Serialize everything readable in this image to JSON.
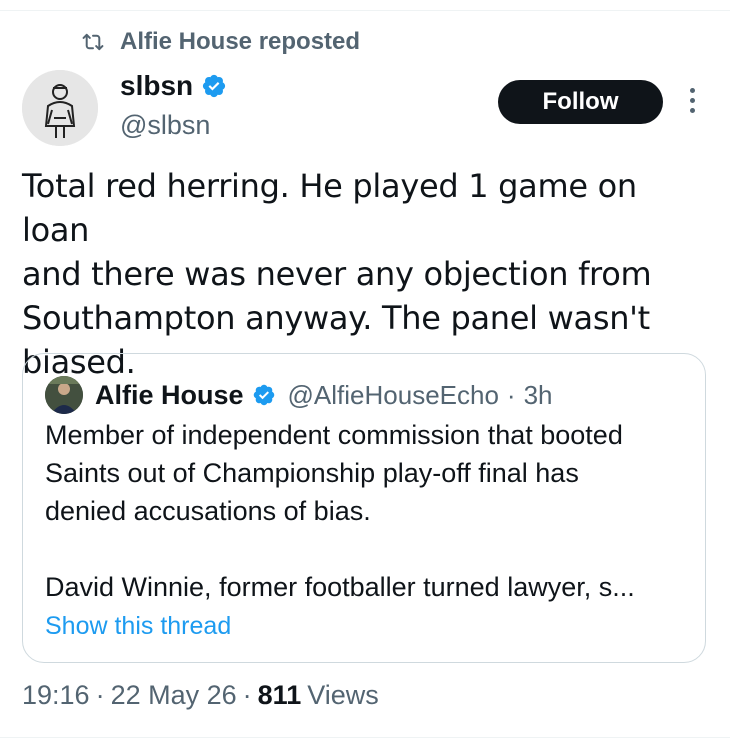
{
  "repost": {
    "text": "Alfie House reposted",
    "icon": "repost-icon"
  },
  "author": {
    "name": "slbsn",
    "handle": "@slbsn",
    "verified": true
  },
  "follow_label": "Follow",
  "post_text": "Total red herring. He played 1 game on loan\nand there was never any objection from\nSouthampton anyway. The panel wasn't\nbiased.",
  "quote": {
    "name": "Alfie House",
    "handle": "@AlfieHouseEcho",
    "separator": "·",
    "time": "3h",
    "text": "Member of independent commission that booted\nSaints out of Championship play-off final has\ndenied accusations of bias.",
    "text2": "David Winnie, former footballer turned lawyer, s...",
    "link": "Show this thread"
  },
  "meta": {
    "time": "19:16",
    "sep1": "·",
    "date": "22 May 26",
    "sep2": "·",
    "views_count": "811",
    "views_label": "Views"
  },
  "colors": {
    "accent": "#1d9bf0",
    "text": "#0f1419",
    "muted": "#536471",
    "border": "#cfd9de"
  }
}
